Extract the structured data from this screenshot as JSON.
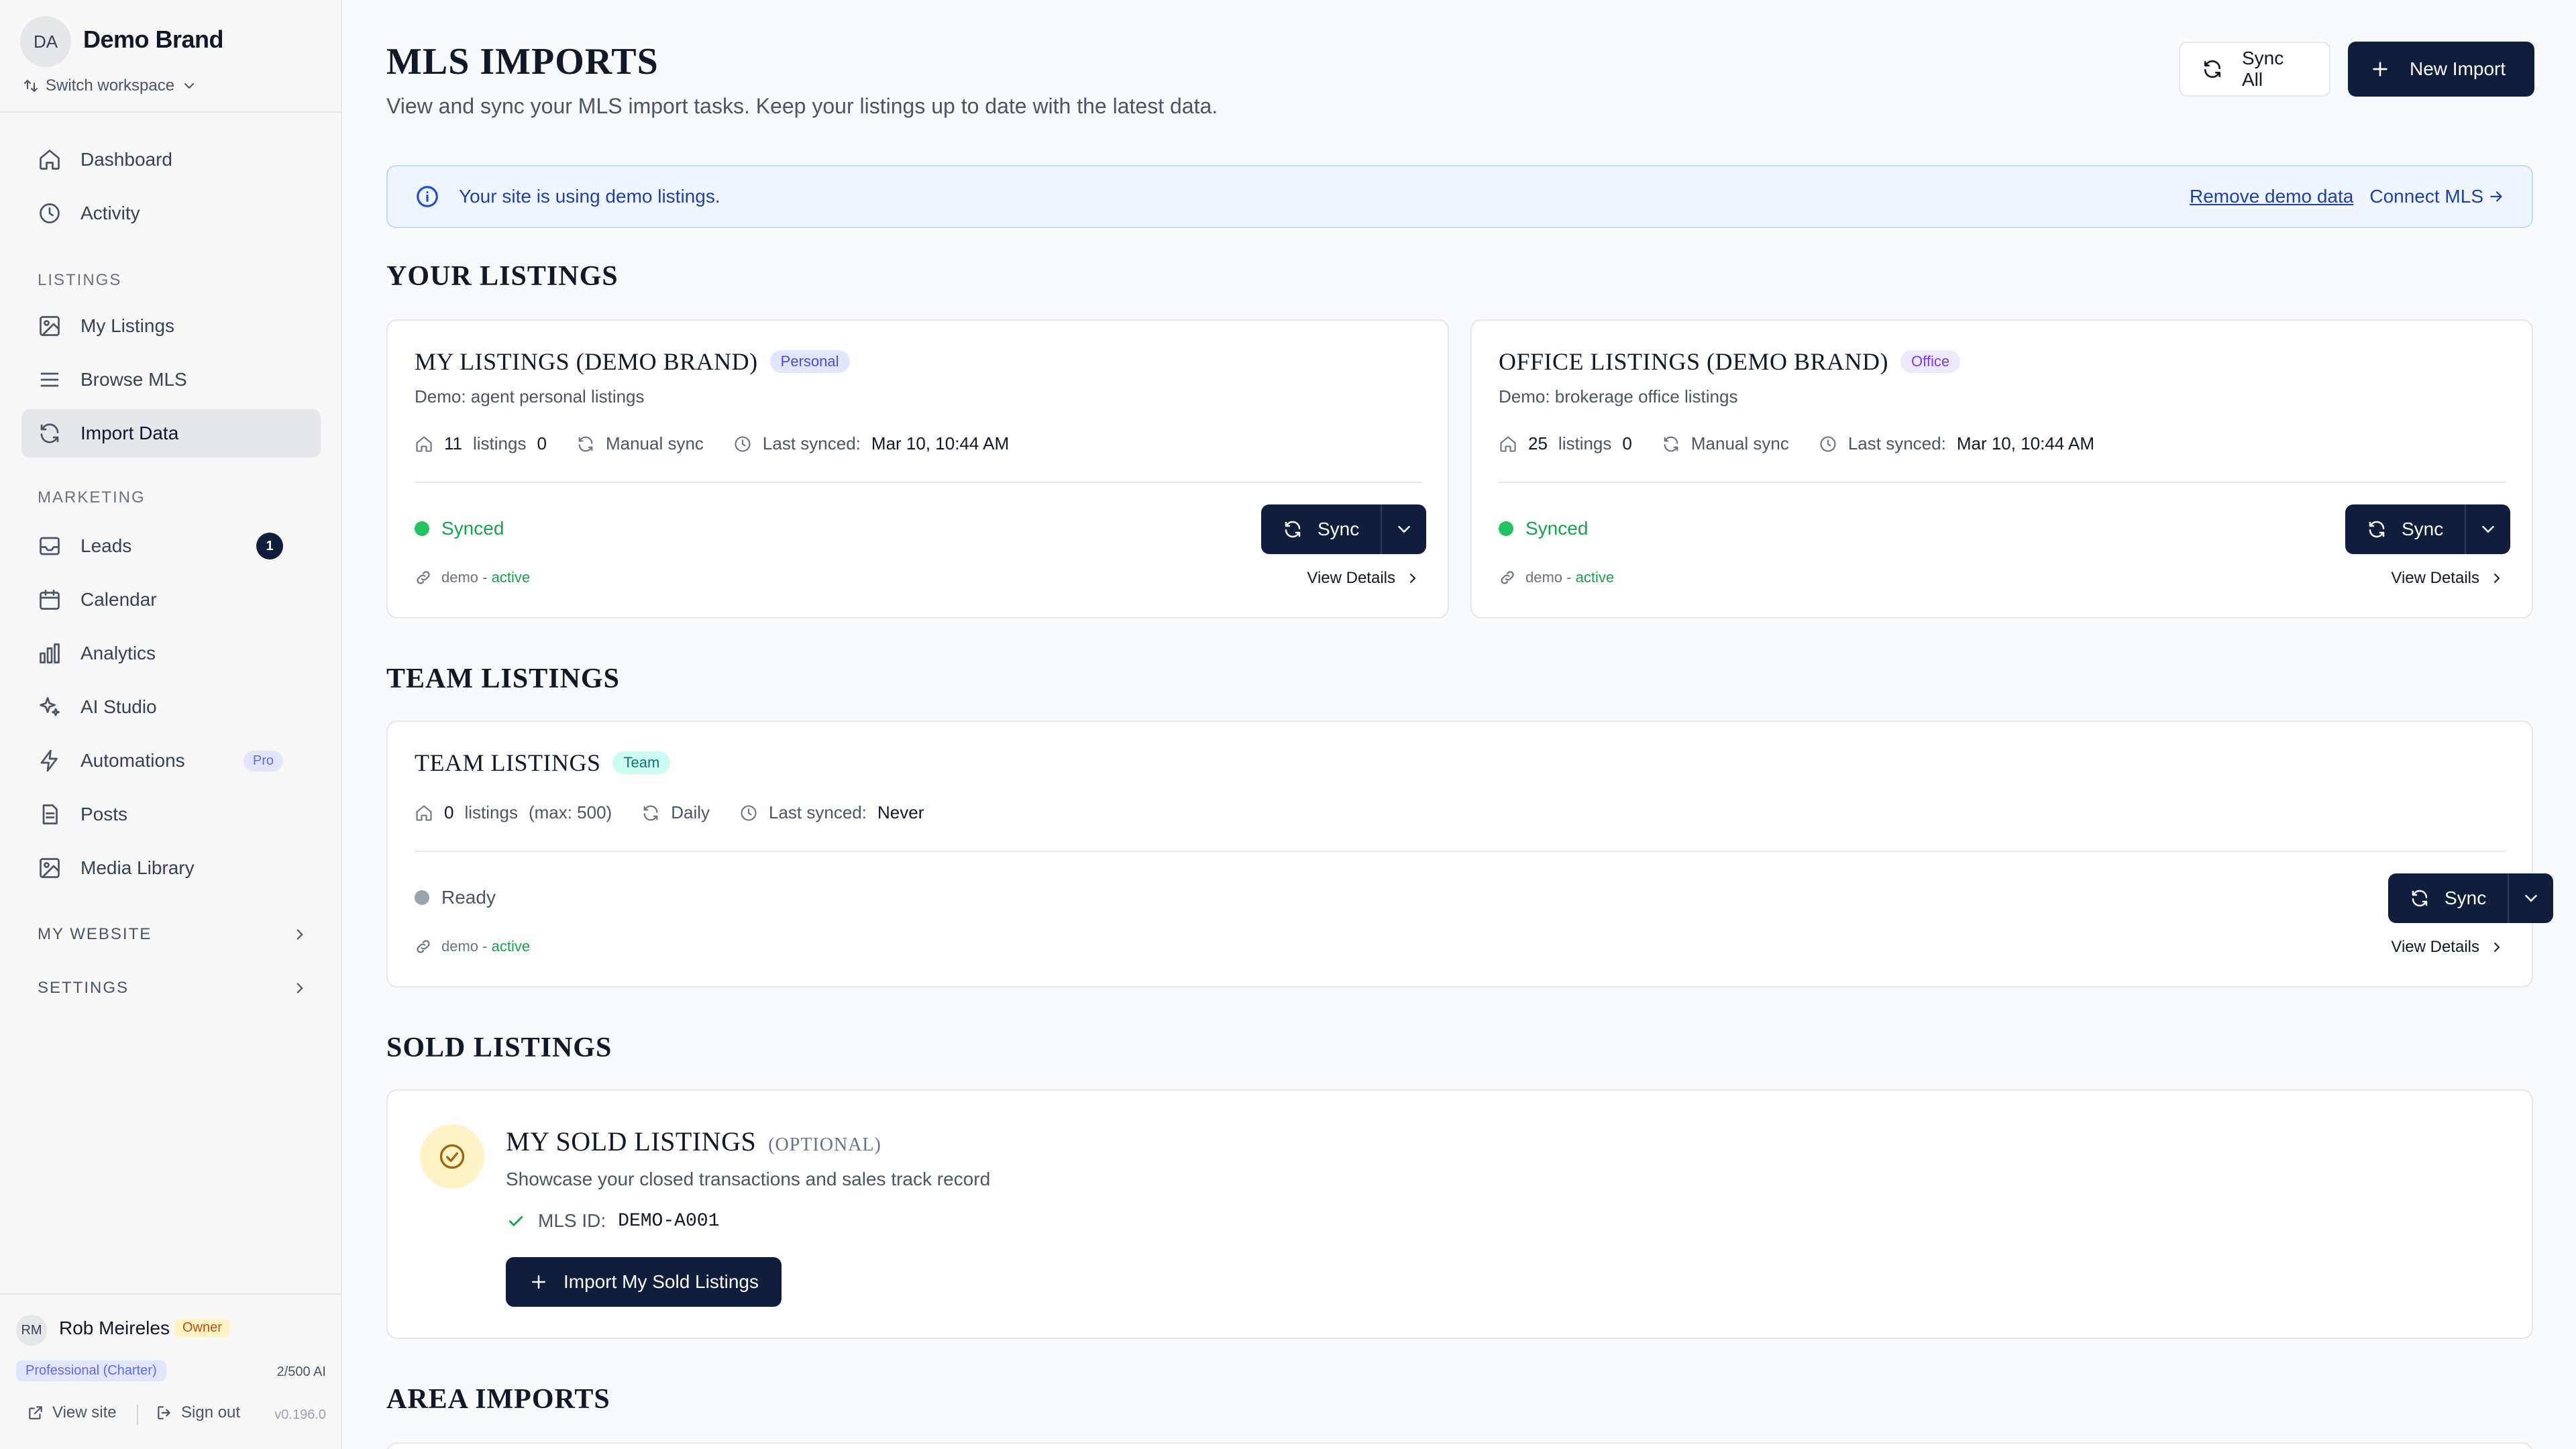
{
  "workspace": {
    "initials": "DA",
    "name": "Demo Brand",
    "switch_label": "Switch workspace"
  },
  "nav": {
    "dashboard": "Dashboard",
    "activity": "Activity",
    "listings_section": "LISTINGS",
    "my_listings": "My Listings",
    "browse_mls": "Browse MLS",
    "import_data": "Import Data",
    "marketing_section": "MARKETING",
    "leads": "Leads",
    "leads_count": "1",
    "calendar": "Calendar",
    "analytics": "Analytics",
    "ai_studio": "AI Studio",
    "automations": "Automations",
    "automations_badge": "Pro",
    "posts": "Posts",
    "media_library": "Media Library",
    "my_website": "MY WEBSITE",
    "settings": "SETTINGS"
  },
  "user": {
    "initials": "RM",
    "name": "Rob Meireles",
    "role": "Owner",
    "plan": "Professional (Charter)",
    "ai_usage": "2/500 AI",
    "view_site": "View site",
    "sign_out": "Sign out",
    "version": "v0.196.0"
  },
  "page": {
    "title": "MLS IMPORTS",
    "subtitle": "View and sync your MLS import tasks. Keep your listings up to date with the latest data.",
    "sync_all": "Sync All",
    "new_import": "New Import"
  },
  "banner": {
    "text": "Your site is using demo listings.",
    "remove": "Remove demo data",
    "connect": "Connect MLS"
  },
  "sections": {
    "your_listings": "YOUR LISTINGS",
    "team_listings": "TEAM LISTINGS",
    "sold_listings": "SOLD LISTINGS",
    "area_imports": "AREA IMPORTS"
  },
  "cards": {
    "my": {
      "title": "MY LISTINGS (DEMO BRAND)",
      "tag": "Personal",
      "desc": "Demo: agent personal listings",
      "count": "11",
      "count_label": "listings",
      "extra": "0",
      "sync_mode": "Manual sync",
      "last_synced_label": "Last synced:",
      "last_synced": "Mar 10, 10:44 AM",
      "status": "Synced",
      "source": "demo",
      "source_sep": " - ",
      "source_state": "active",
      "sync_label": "Sync",
      "view_details": "View Details"
    },
    "office": {
      "title": "OFFICE LISTINGS (DEMO BRAND)",
      "tag": "Office",
      "desc": "Demo: brokerage office listings",
      "count": "25",
      "count_label": "listings",
      "extra": "0",
      "sync_mode": "Manual sync",
      "last_synced_label": "Last synced:",
      "last_synced": "Mar 10, 10:44 AM",
      "status": "Synced",
      "source": "demo",
      "source_sep": " - ",
      "source_state": "active",
      "sync_label": "Sync",
      "view_details": "View Details"
    },
    "team": {
      "title": "TEAM LISTINGS",
      "tag": "Team",
      "count": "0",
      "count_label": "listings",
      "max": "(max: 500)",
      "sync_mode": "Daily",
      "last_synced_label": "Last synced:",
      "last_synced": "Never",
      "status": "Ready",
      "source": "demo",
      "source_sep": " - ",
      "source_state": "active",
      "sync_label": "Sync",
      "view_details": "View Details"
    },
    "sold": {
      "title": "MY SOLD LISTINGS",
      "optional": "(OPTIONAL)",
      "desc": "Showcase your closed transactions and sales track record",
      "mls_label": "MLS ID:",
      "mls_value": "DEMO-A001",
      "button": "Import My Sold Listings"
    }
  }
}
